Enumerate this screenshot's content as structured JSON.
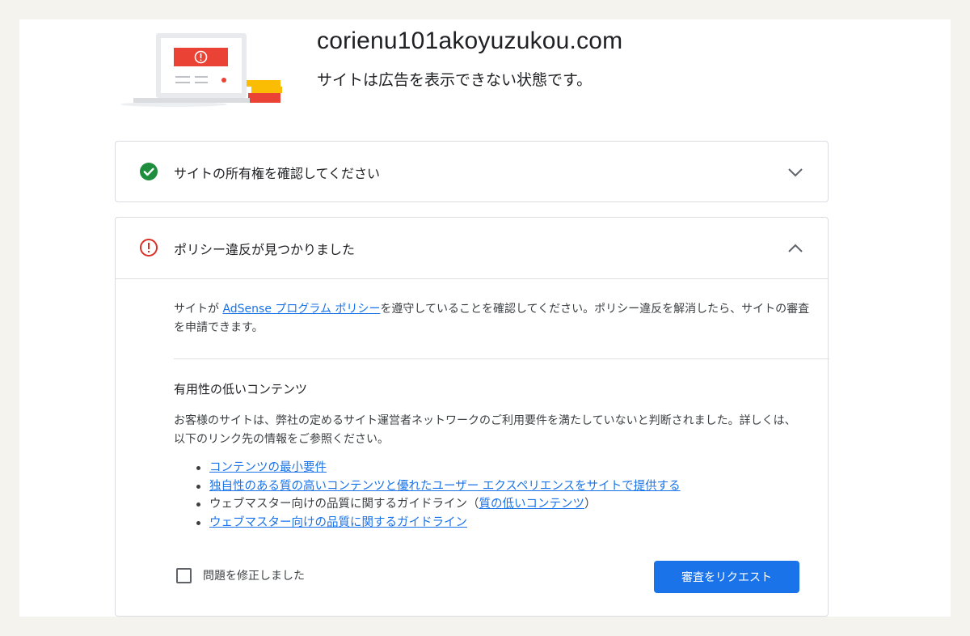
{
  "header": {
    "domain": "corienu101akoyuzukou.com",
    "subtitle": "サイトは広告を表示できない状態です。"
  },
  "colors": {
    "accent_blue": "#1a73e8",
    "success_green": "#1e8e3e",
    "error_red": "#d93025",
    "page_background": "#f5f3ee"
  },
  "cards": {
    "verify": {
      "title": "サイトの所有権を確認してください",
      "status_icon": "check-circle-icon",
      "chevron_icon": "chevron-down-icon"
    },
    "policy": {
      "title": "ポリシー違反が見つかりました",
      "status_icon": "error-circle-icon",
      "chevron_icon": "chevron-up-icon",
      "intro_before": "サイトが ",
      "intro_link": "AdSense プログラム ポリシー",
      "intro_after": "を遵守していることを確認してください。ポリシー違反を解消したら、サイトの審査を申請できます。",
      "section_title": "有用性の低いコンテンツ",
      "description": "お客様のサイトは、弊社の定めるサイト運営者ネットワークのご利用要件を満たしていないと判断されました。詳しくは、以下のリンク先の情報をご参照ください。",
      "links": [
        {
          "text": "コンテンツの最小要件"
        },
        {
          "text": "独自性のある質の高いコンテンツと優れたユーザー エクスペリエンスをサイトで提供する"
        },
        {
          "prefix": "ウェブマスター向けの品質に関するガイドライン（",
          "text": "質の低いコンテンツ",
          "suffix": "）"
        },
        {
          "text": "ウェブマスター向けの品質に関するガイドライン"
        }
      ],
      "checkbox_label": "問題を修正しました",
      "button_label": "審査をリクエスト"
    }
  }
}
